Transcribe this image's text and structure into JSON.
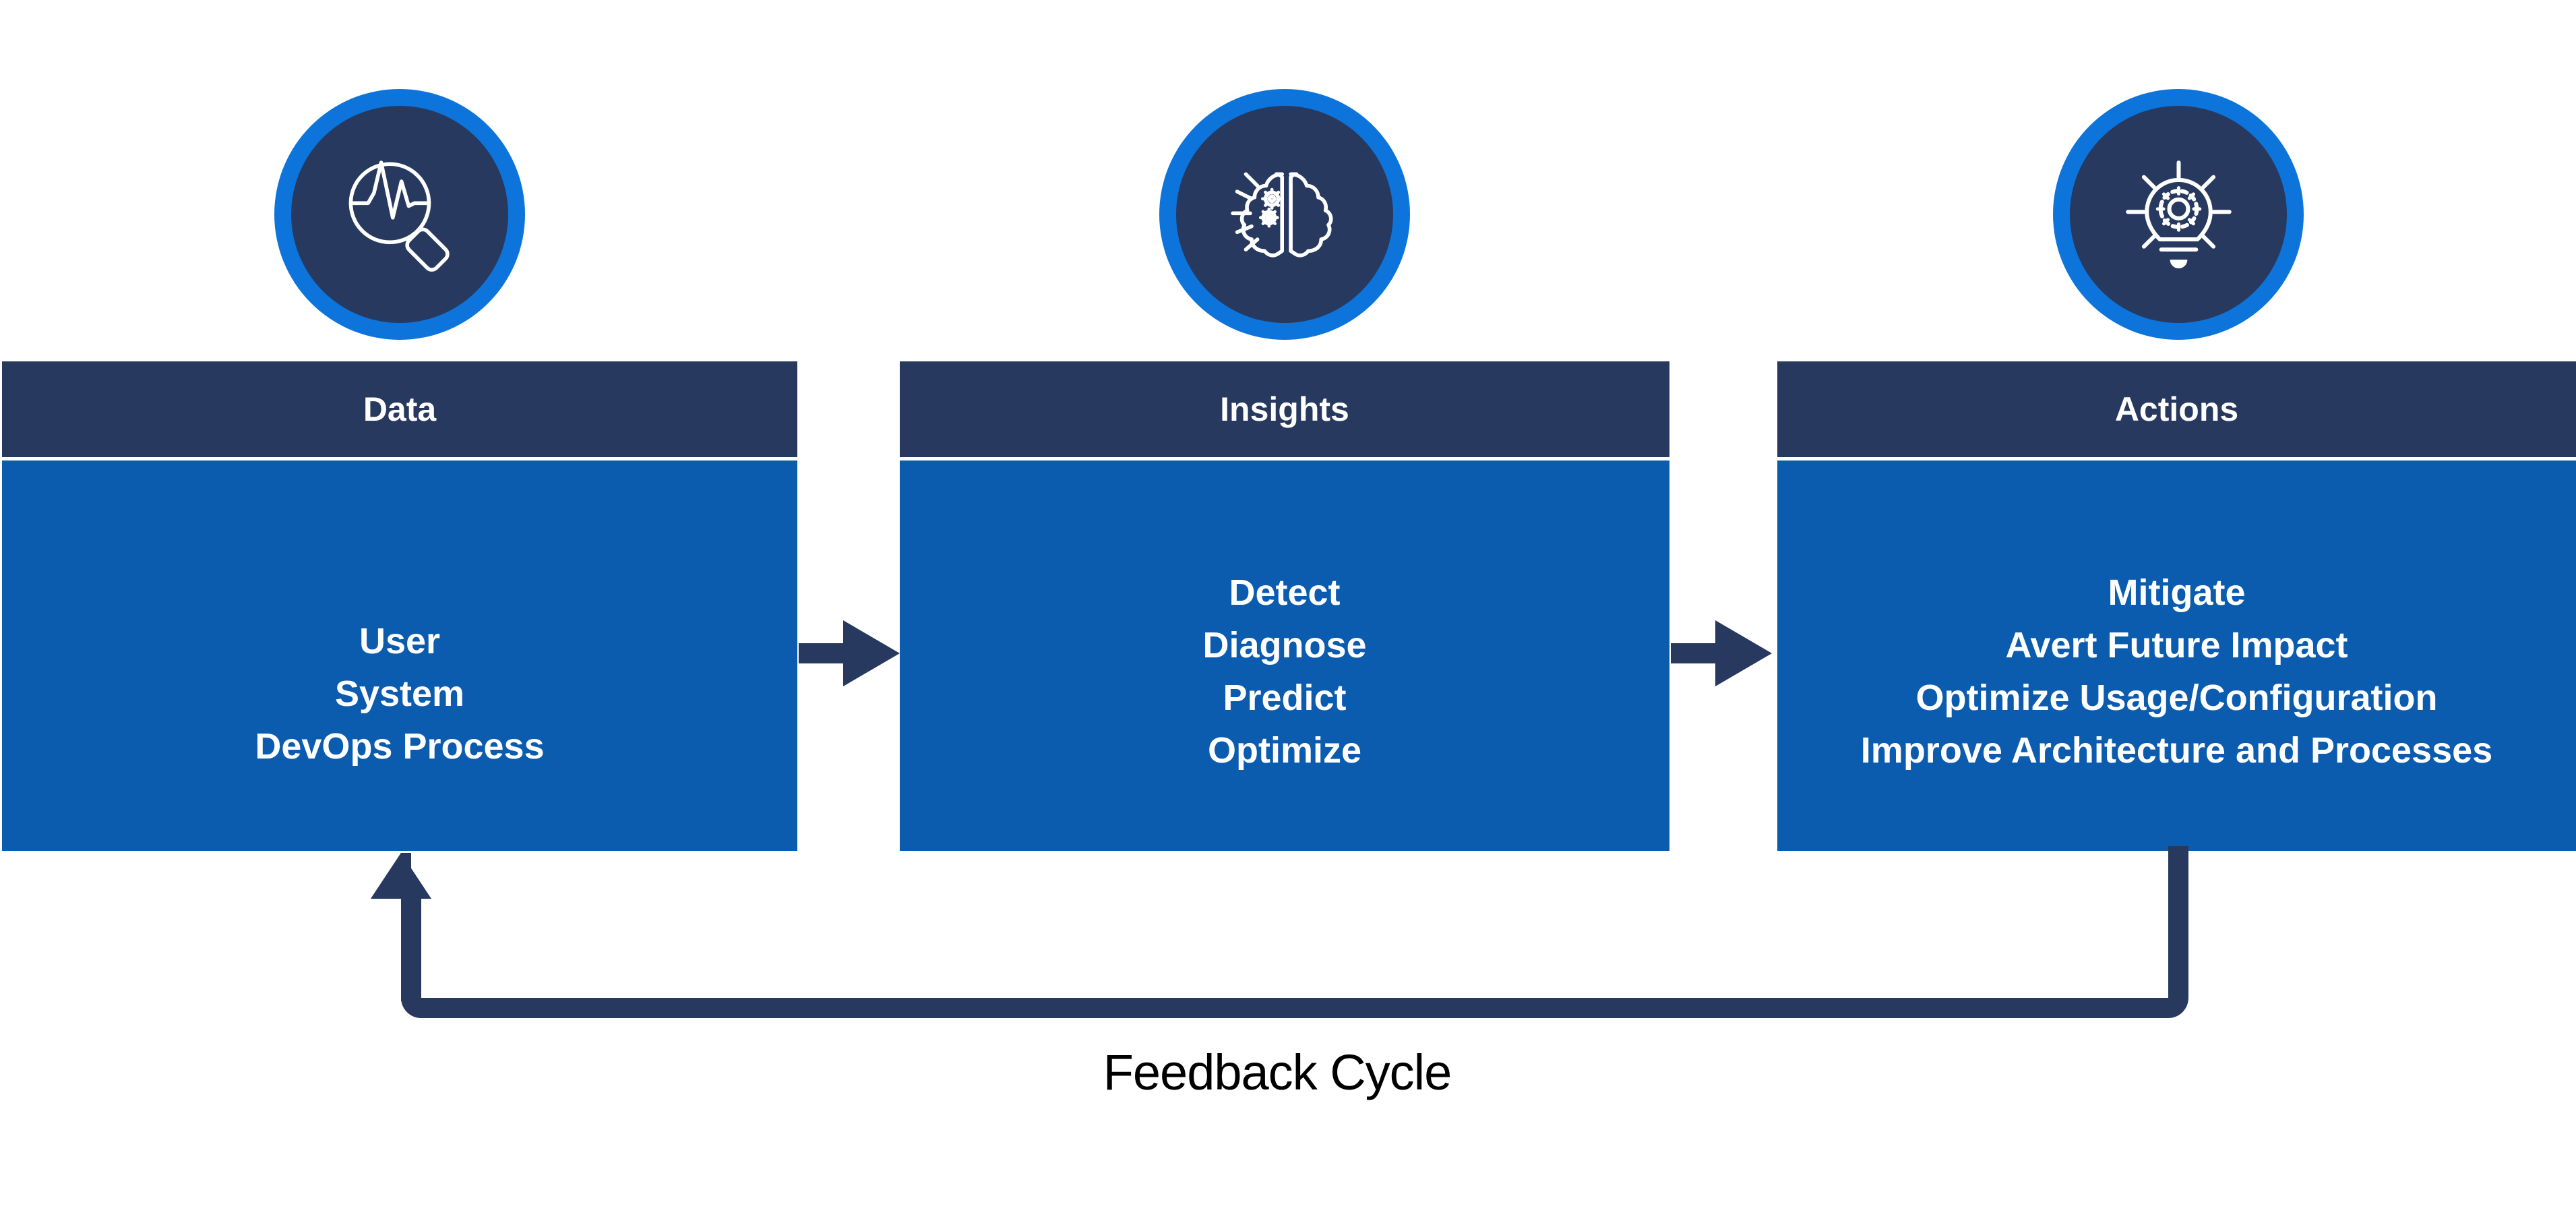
{
  "diagram": {
    "title_text": "Feedback Cycle",
    "colors": {
      "navy": "#27395f",
      "blue": "#0b5cae",
      "ring_blue": "#0c74db",
      "white": "#ffffff",
      "black": "#000000"
    },
    "stages": [
      {
        "id": "data",
        "icon": "magnifier-pulse-icon",
        "header": "Data",
        "items": [
          "User",
          "System",
          "DevOps Process"
        ]
      },
      {
        "id": "insights",
        "icon": "brain-gears-icon",
        "header": "Insights",
        "items": [
          "Detect",
          "Diagnose",
          "Predict",
          "Optimize"
        ]
      },
      {
        "id": "actions",
        "icon": "lightbulb-gear-icon",
        "header": "Actions",
        "items": [
          "Mitigate",
          "Avert Future Impact",
          "Optimize Usage/Configuration",
          "Improve Architecture and Processes"
        ]
      }
    ],
    "connectors": [
      {
        "id": "data-to-insights",
        "icon": "arrow-right-icon"
      },
      {
        "id": "insights-to-actions",
        "icon": "arrow-right-icon"
      }
    ],
    "feedback": {
      "icon": "feedback-loop-arrow-icon",
      "label": "Feedback Cycle"
    }
  }
}
